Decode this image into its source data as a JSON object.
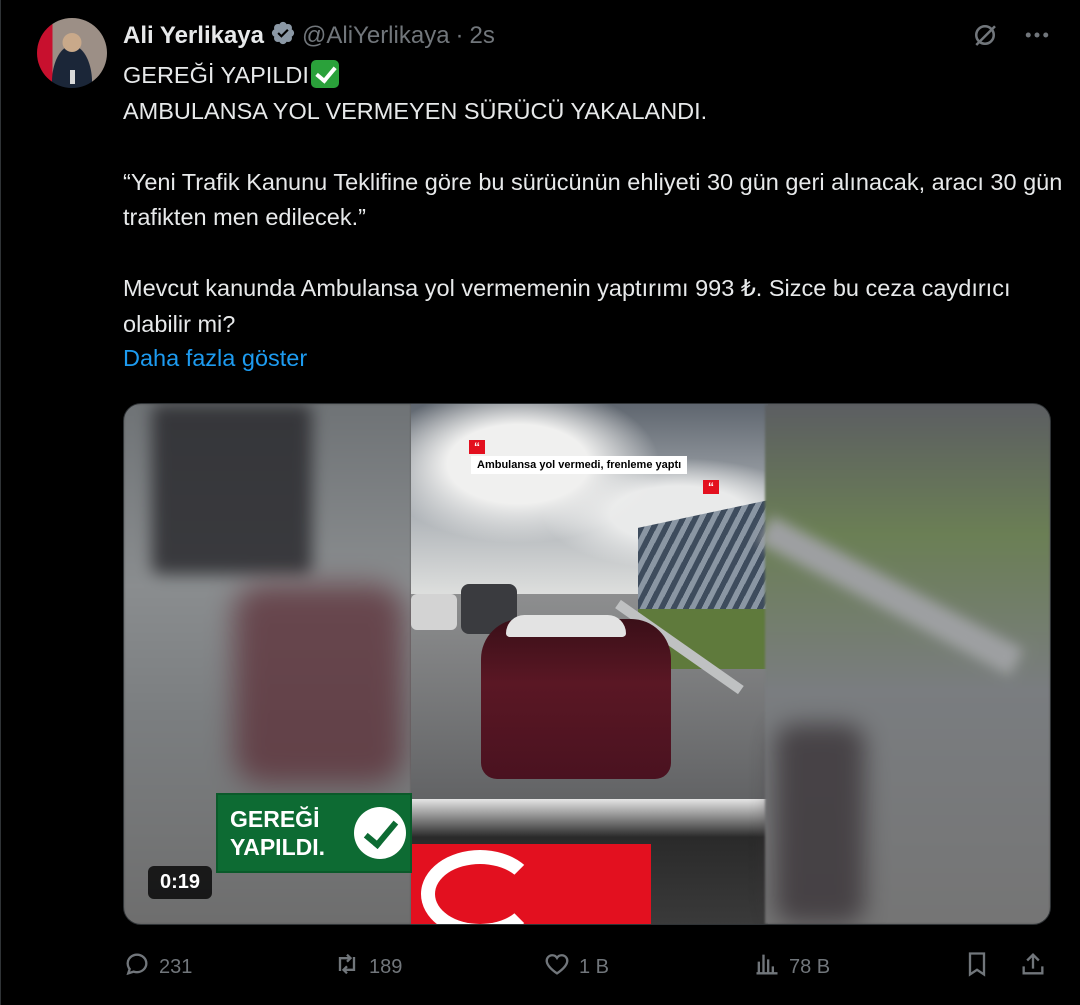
{
  "author": {
    "name": "Ali Yerlikaya",
    "handle": "@AliYerlikaya",
    "separator": "·",
    "time": "2s"
  },
  "tweet": {
    "line1": "GEREĞİ YAPILDI",
    "line2": "AMBULANSA YOL VERMEYEN SÜRÜCÜ YAKALANDI.",
    "quote": "“Yeni Trafik Kanunu Teklifine göre bu sürücünün ehliyeti 30 gün geri alınacak, aracı 30 gün trafikten men edilecek.”",
    "para3": "Mevcut kanunda Ambulansa yol vermemenin yaptırımı 993 ₺. Sizce bu ceza caydırıcı olabilir mi?",
    "show_more": "Daha fazla göster"
  },
  "media": {
    "headline": "Ambulansa yol vermedi, frenleme yaptı",
    "quote_mark": "“",
    "badge_text": "GEREĞİ YAPILDI.",
    "duration": "0:19"
  },
  "actions": {
    "replies": "231",
    "reposts": "189",
    "likes": "1 B",
    "views": "78 B"
  },
  "icons": {
    "verified": "verified-badge-icon",
    "grok": "grok-icon",
    "more": "more-icon",
    "reply": "reply-icon",
    "repost": "repost-icon",
    "like": "heart-icon",
    "views": "views-icon",
    "bookmark": "bookmark-icon",
    "share": "share-icon"
  },
  "colors": {
    "background": "#000000",
    "text": "#e7e9ea",
    "secondary": "#71767b",
    "link": "#1d9bf0",
    "badge_green": "#0d6b33"
  }
}
